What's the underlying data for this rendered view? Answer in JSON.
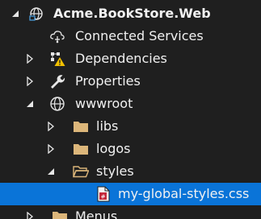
{
  "tree": {
    "project": {
      "label": "Acme.BookStore.Web",
      "icon": "web-project-icon",
      "expanded": true
    },
    "items": [
      {
        "label": "Connected Services",
        "icon": "connected-services-icon",
        "expandable": false
      },
      {
        "label": "Dependencies",
        "icon": "dependencies-warning-icon",
        "expandable": true,
        "expanded": false
      },
      {
        "label": "Properties",
        "icon": "wrench-icon",
        "expandable": true,
        "expanded": false
      },
      {
        "label": "wwwroot",
        "icon": "globe-icon",
        "expandable": true,
        "expanded": true
      },
      {
        "label": "libs",
        "icon": "folder-icon",
        "expandable": true,
        "expanded": false
      },
      {
        "label": "logos",
        "icon": "folder-icon",
        "expandable": true,
        "expanded": false
      },
      {
        "label": "styles",
        "icon": "folder-open-icon",
        "expandable": true,
        "expanded": true
      },
      {
        "label": "my-global-styles.css",
        "icon": "css-file-icon",
        "expandable": false,
        "selected": true
      },
      {
        "label": "Menus",
        "icon": "folder-icon",
        "expandable": true,
        "expanded": false
      }
    ]
  },
  "colors": {
    "background": "#1f1f1f",
    "selection": "#0a74d8",
    "folder": "#dcb67a",
    "text": "#f1f1f1"
  }
}
